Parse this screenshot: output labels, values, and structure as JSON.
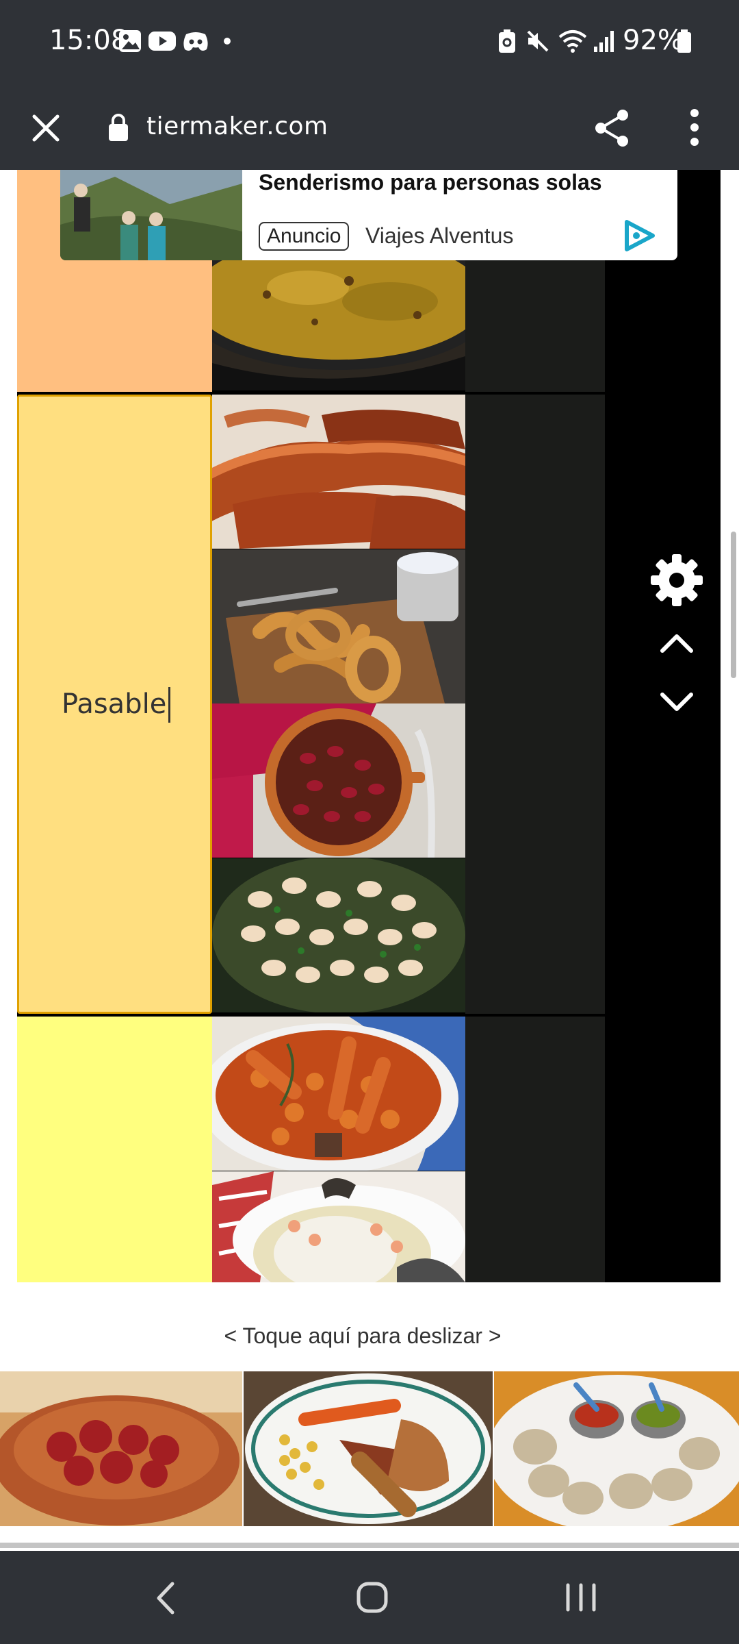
{
  "status_bar": {
    "time": "15:08",
    "battery": "92%",
    "icons": [
      "gallery-icon",
      "youtube-icon",
      "discord-icon",
      "dot-icon",
      "battery-saver-icon",
      "mute-icon",
      "wifi-icon",
      "signal-icon",
      "battery-icon"
    ]
  },
  "browser": {
    "url": "tiermaker.com",
    "icons": [
      "close-icon",
      "lock-icon",
      "share-icon",
      "more-vert-icon"
    ]
  },
  "ad": {
    "title": "Senderismo para personas solas",
    "badge": "Anuncio",
    "advertiser": "Viajes Alventus"
  },
  "tiers": [
    {
      "label": "",
      "color": "#ffbf80"
    },
    {
      "label": "Pasable",
      "color": "#ffdf80",
      "selected": true
    },
    {
      "label": "",
      "color": "#ffff7f"
    }
  ],
  "tier_controls": [
    "gear-icon",
    "chevron-up-icon",
    "chevron-down-icon"
  ],
  "swipe_hint": "< Toque aquí para deslizar >",
  "nav": [
    "back-icon",
    "home-icon",
    "recents-icon"
  ]
}
